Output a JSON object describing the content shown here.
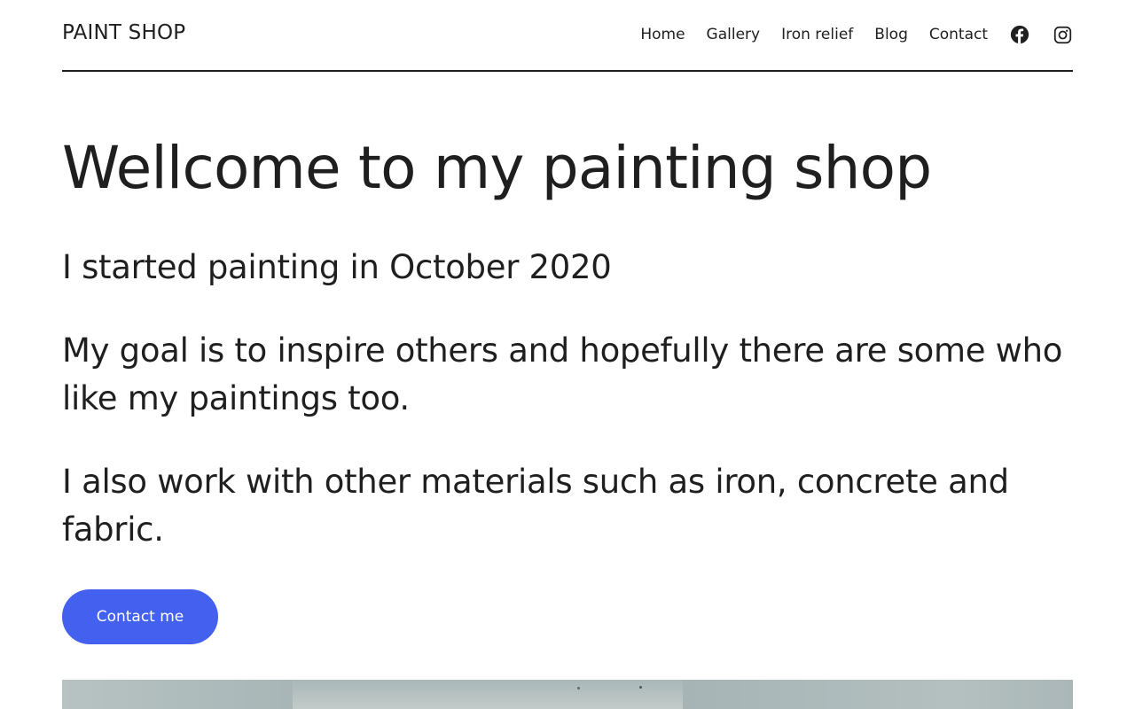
{
  "header": {
    "site_title": "PAINT SHOP",
    "nav": [
      {
        "label": "Home"
      },
      {
        "label": "Gallery"
      },
      {
        "label": "Iron relief"
      },
      {
        "label": "Blog"
      },
      {
        "label": "Contact"
      }
    ],
    "social": [
      {
        "icon": "facebook-icon"
      },
      {
        "icon": "instagram-icon"
      }
    ]
  },
  "main": {
    "title": "Wellcome to my painting shop",
    "paragraphs": [
      "I started painting in October 2020",
      "My goal is to inspire others and hopefully there are some who like my paintings too.",
      "I also work with other materials such as iron, concrete and fabric."
    ],
    "cta_label": "Contact me"
  },
  "colors": {
    "accent": "#4460ef",
    "text": "#1f1f1f",
    "background": "#ffffff"
  }
}
